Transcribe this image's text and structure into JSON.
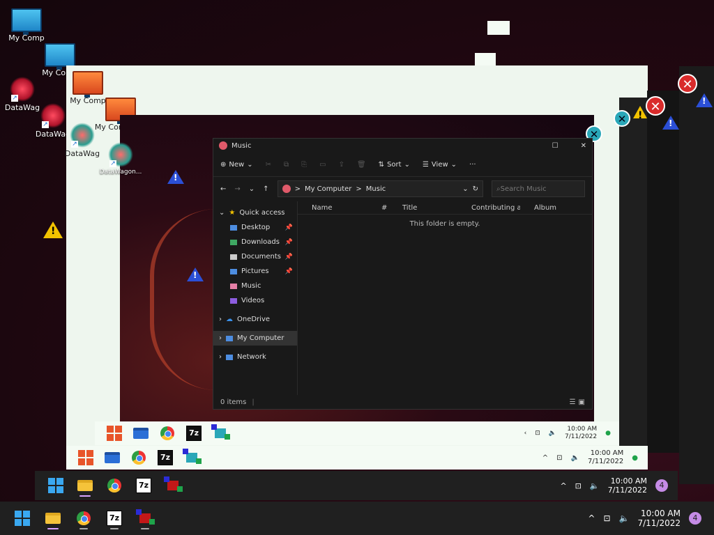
{
  "desktop": {
    "icons": [
      {
        "label": "My Comp"
      },
      {
        "label": "My Comp"
      },
      {
        "label": "DataWag"
      },
      {
        "label": "DataWag"
      },
      {
        "label": "My Comp"
      },
      {
        "label": "My Computer"
      },
      {
        "label": "DataWag"
      },
      {
        "label": "DataWagon..."
      }
    ]
  },
  "explorer": {
    "title": "Music",
    "toolbar": {
      "new": "New",
      "sort": "Sort",
      "view": "View",
      "more": "···"
    },
    "address": {
      "crumbs": [
        "My Computer",
        "Music"
      ],
      "separator": ">",
      "search_placeholder": "Search Music"
    },
    "nav": {
      "quick_access": "Quick access",
      "items": [
        {
          "label": "Desktop",
          "pinned": true
        },
        {
          "label": "Downloads",
          "pinned": true
        },
        {
          "label": "Documents",
          "pinned": true
        },
        {
          "label": "Pictures",
          "pinned": true
        },
        {
          "label": "Music",
          "pinned": false
        },
        {
          "label": "Videos",
          "pinned": false
        }
      ],
      "onedrive": "OneDrive",
      "my_computer": "My Computer",
      "network": "Network"
    },
    "columns": [
      "Name",
      "#",
      "Title",
      "Contributing artists",
      "Album"
    ],
    "empty_message": "This folder is empty.",
    "status": "0 items"
  },
  "taskbars": [
    {
      "time": "10:00 AM",
      "date": "7/11/2022",
      "badge": "4"
    },
    {
      "time": "10:00 AM",
      "date": "7/11/2022",
      "badge": "4"
    },
    {
      "time": "10:00 AM",
      "date": "7/11/2022"
    },
    {
      "time": "10:00 AM",
      "date": "7/11/2022"
    }
  ],
  "colors": {
    "accent": "#3aa8f0",
    "taskbar_bg": "#202020",
    "explorer_bg": "#191919",
    "error": "#d92b2b",
    "warning": "#f2c200"
  }
}
